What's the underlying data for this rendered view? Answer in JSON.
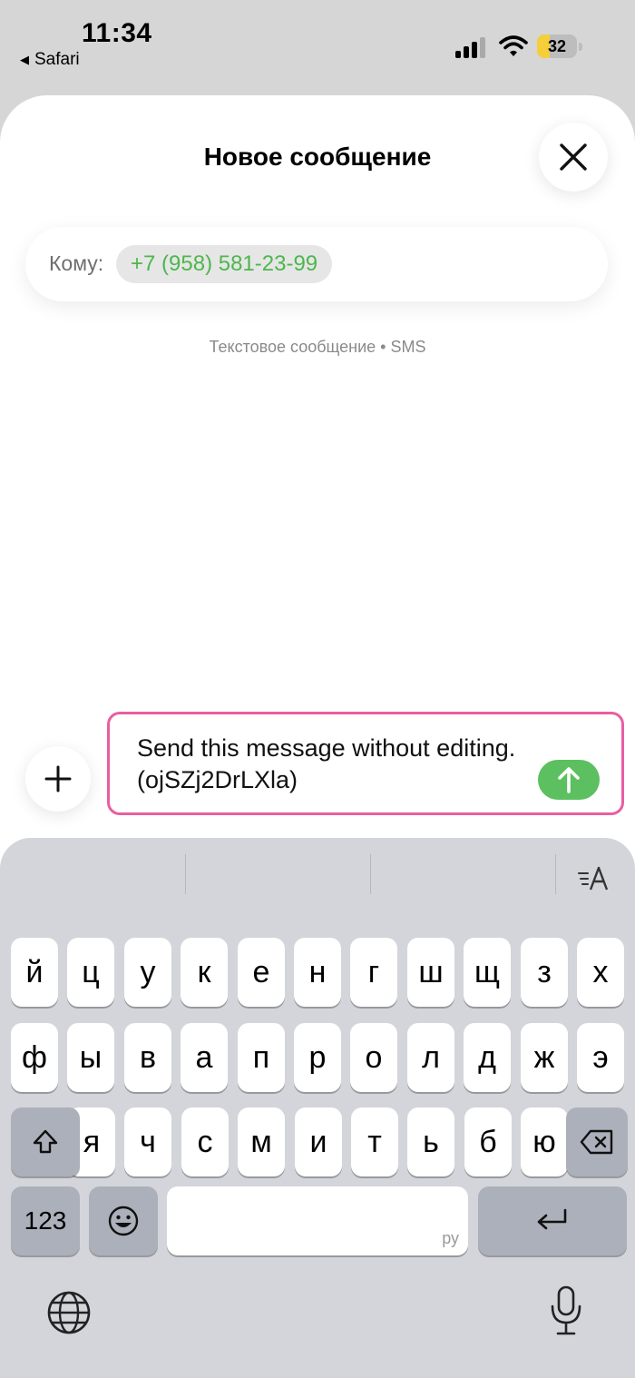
{
  "status_bar": {
    "time": "11:34",
    "back_app": "Safari",
    "battery_level": "32",
    "battery_fraction": 0.32,
    "signal_bars_active": 3,
    "signal_bars_total": 4
  },
  "sheet": {
    "title": "Новое сообщение",
    "to_label": "Кому:",
    "recipient": "+7 (958) 581-23-99",
    "service_label": "Текстовое сообщение • SMS"
  },
  "compose": {
    "text": "Send this message without editing. (ojSZj2DrLXla)"
  },
  "keyboard": {
    "row1": [
      "й",
      "ц",
      "у",
      "к",
      "е",
      "н",
      "г",
      "ш",
      "щ",
      "з",
      "х"
    ],
    "row2": [
      "ф",
      "ы",
      "в",
      "а",
      "п",
      "р",
      "о",
      "л",
      "д",
      "ж",
      "э"
    ],
    "row3": [
      "я",
      "ч",
      "с",
      "м",
      "и",
      "т",
      "ь",
      "б",
      "ю"
    ],
    "numbers_key": "123",
    "space_language": "ру"
  },
  "colors": {
    "accent_green": "#5cc060",
    "recipient_green": "#4cb74c",
    "compose_border": "#e95ea0",
    "battery_yellow": "#f5cf3a"
  },
  "icons": [
    "back-triangle-icon",
    "signal-icon",
    "wifi-icon",
    "battery-icon",
    "close-icon",
    "plus-icon",
    "send-arrow-icon",
    "text-format-icon",
    "shift-icon",
    "backspace-icon",
    "emoji-icon",
    "return-icon",
    "globe-icon",
    "microphone-icon"
  ]
}
